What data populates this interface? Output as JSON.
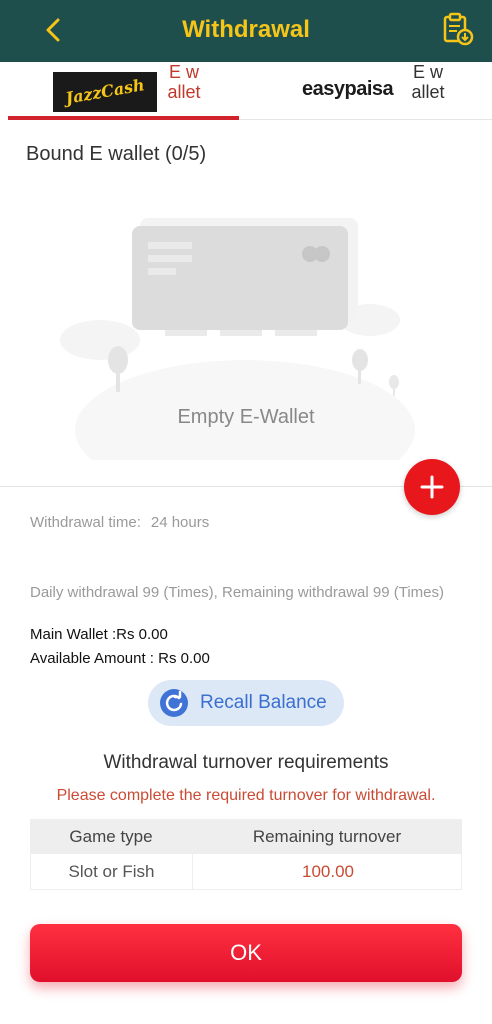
{
  "header": {
    "title": "Withdrawal",
    "back_icon": "chevron-left-icon",
    "records_icon": "clipboard-download-icon",
    "background": "#1f4f4c",
    "title_color": "#f5c518"
  },
  "tabs": [
    {
      "logo_text": "JazzCash",
      "label": "E wallet",
      "active": true
    },
    {
      "logo_text": "easypaisa",
      "label": "E wallet",
      "active": false
    }
  ],
  "wallets": {
    "bound_title": "Bound E wallet (0/5)",
    "empty_text": "Empty E-Wallet"
  },
  "info": {
    "withdrawal_time_label": "Withdrawal time:",
    "withdrawal_time_value": "24 hours",
    "daily_text": "Daily withdrawal 99 (Times), Remaining withdrawal 99 (Times)",
    "main_wallet": "Main Wallet :Rs 0.00",
    "available_amount": "Available Amount : Rs 0.00"
  },
  "recall": {
    "label": "Recall Balance",
    "icon": "refresh-icon"
  },
  "turnover": {
    "title": "Withdrawal turnover requirements",
    "warning": "Please complete the required turnover for withdrawal.",
    "columns": [
      "Game type",
      "Remaining turnover"
    ],
    "rows": [
      {
        "game_type": "Slot or Fish",
        "remaining": "100.00"
      }
    ]
  },
  "ok_button": {
    "label": "OK"
  },
  "colors": {
    "accent_red": "#e8171c",
    "warning": "#c94b33",
    "recall_blue": "#3a6fd0"
  }
}
